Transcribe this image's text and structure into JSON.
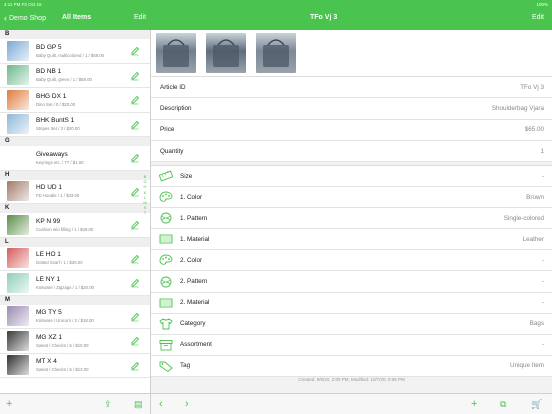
{
  "status": {
    "time": "4:11 PM",
    "date": "Fri Oct 16",
    "battery": "100%"
  },
  "nav": {
    "back": "Demo Shop",
    "list_title": "All Items",
    "list_edit": "Edit",
    "detail_title": "TFo Vj 3",
    "detail_edit": "Edit"
  },
  "sections": [
    {
      "letter": "B",
      "items": [
        {
          "name": "BD GP 5",
          "sub": "Baby Quilt, multicolored / 1 / $59.00",
          "thumb": "#7aa9d4"
        },
        {
          "name": "BD NB 1",
          "sub": "Baby Quilt, green / 1 / $59.00",
          "thumb": "#6bb88a"
        },
        {
          "name": "BHG DX 1",
          "sub": "Dino Set / 0 / $20.00",
          "thumb": "#e07a3c"
        },
        {
          "name": "BHK BuntS 1",
          "sub": "Stripes Set / 3 / $20.00",
          "thumb": "#8fb7d9"
        }
      ]
    },
    {
      "letter": "G",
      "items": [
        {
          "name": "Giveaways",
          "sub": "Keyrings etc. / 77 / $1.00",
          "thumb": ""
        }
      ]
    },
    {
      "letter": "H",
      "items": [
        {
          "name": "HD UD 1",
          "sub": "FD Hoodie / 1 / $33.00",
          "thumb": "#a07a6a"
        }
      ]
    },
    {
      "letter": "K",
      "items": [
        {
          "name": "KP N 99",
          "sub": "Cushion w/o filling / 1 / $29.00",
          "thumb": "#5a8f4a"
        }
      ]
    },
    {
      "letter": "L",
      "items": [
        {
          "name": "LE HO 1",
          "sub": "Dotted Scarf / 1 / $20.00",
          "thumb": "#d65a5a"
        },
        {
          "name": "LE NY 1",
          "sub": "Knitware / Zigzags / 1 / $20.00",
          "thumb": "#8fcfb8"
        }
      ]
    },
    {
      "letter": "M",
      "items": [
        {
          "name": "MG TY 5",
          "sub": "Knitware / Unicorn / 2 / $18.00",
          "thumb": "#9a8ab0"
        },
        {
          "name": "MG XZ 1",
          "sub": "Sweat / Checks / 5 / $10.00",
          "thumb": "#3a3a3a"
        },
        {
          "name": "MT X 4",
          "sub": "Sweat / Checks / 5 / $13.00",
          "thumb": "#2f2f2f"
        }
      ]
    }
  ],
  "index_letters": [
    "B",
    "G",
    "H",
    "K",
    "L",
    "M",
    "S",
    "T"
  ],
  "photos": [
    {
      "tone": "#6f7f8e"
    },
    {
      "tone": "#5f6e7c"
    },
    {
      "tone": "#7c8895"
    }
  ],
  "details": [
    {
      "label": "Article ID",
      "value": "TFo Vj 3"
    },
    {
      "label": "Description",
      "value": "Shoulderbag Vjara"
    },
    {
      "label": "Price",
      "value": "$65.00"
    },
    {
      "label": "Quantity",
      "value": "1"
    }
  ],
  "attributes": [
    {
      "icon": "ruler-icon",
      "label": "Size",
      "value": "-"
    },
    {
      "icon": "palette-icon",
      "label": "1. Color",
      "value": "Brown"
    },
    {
      "icon": "pattern-icon",
      "label": "1. Pattern",
      "value": "Single-colored"
    },
    {
      "icon": "material-icon",
      "label": "1. Material",
      "value": "Leather"
    },
    {
      "icon": "palette-icon",
      "label": "2. Color",
      "value": "-"
    },
    {
      "icon": "pattern-icon",
      "label": "2. Pattern",
      "value": "-"
    },
    {
      "icon": "material-icon",
      "label": "2. Material",
      "value": "-"
    },
    {
      "icon": "shirt-icon",
      "label": "Category",
      "value": "Bags"
    },
    {
      "icon": "box-icon",
      "label": "Assortment",
      "value": "-"
    },
    {
      "icon": "tag-icon",
      "label": "Tag",
      "value": "Unique Item"
    }
  ],
  "footer": "Created: 9/8/20, 2:00 PM, Modified: 10/7/20, 9:06 PM",
  "colors": {
    "accent": "#4ac34f"
  }
}
